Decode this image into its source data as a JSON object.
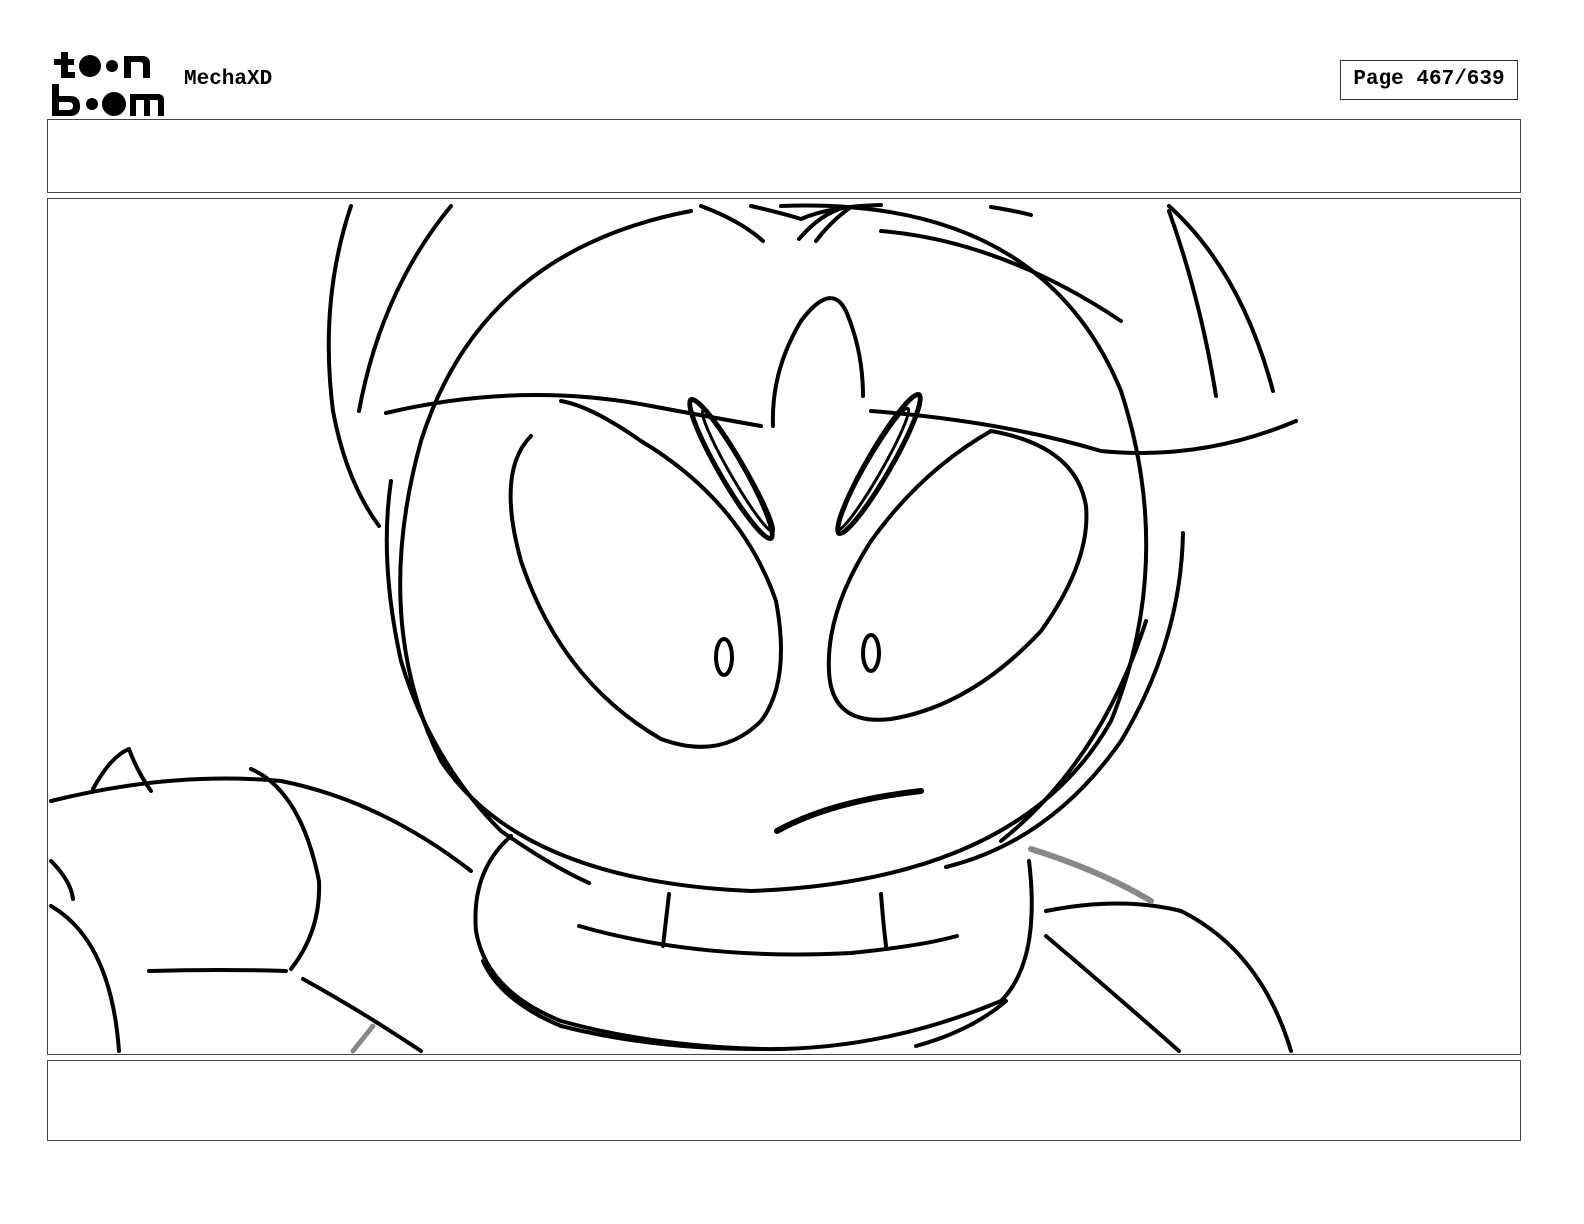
{
  "header": {
    "logo_text": "toon boom",
    "project_title": "MechaXD",
    "page_label": "Page 467/639"
  },
  "panel": {
    "action_notes": "",
    "dialogue_notes": "",
    "drawing": "sketch-character-face"
  }
}
